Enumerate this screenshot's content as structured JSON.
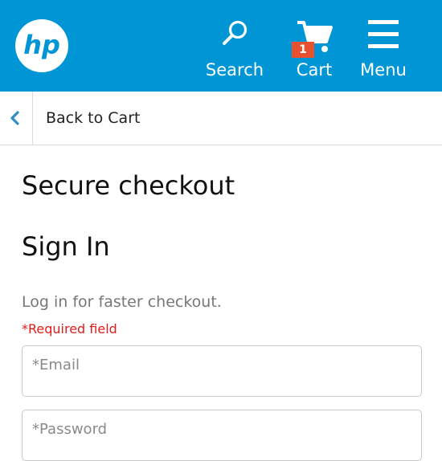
{
  "header": {
    "logo_text": "hp",
    "nav": {
      "search_label": "Search",
      "cart_label": "Cart",
      "cart_count": "1",
      "menu_label": "Menu"
    },
    "icons": [
      "search-icon",
      "cart-icon",
      "menu-icon"
    ]
  },
  "back": {
    "label": "Back to Cart",
    "icon": "chevron-left-icon"
  },
  "main": {
    "title": "Secure checkout",
    "signin_title": "Sign In",
    "subtitle": "Log in for faster checkout.",
    "required_note": "*Required field",
    "email_placeholder": "*Email",
    "password_placeholder": "*Password"
  },
  "colors": {
    "brand_blue": "#0096d6",
    "badge_orange": "#e8512f",
    "required_red": "#e21b1b"
  }
}
